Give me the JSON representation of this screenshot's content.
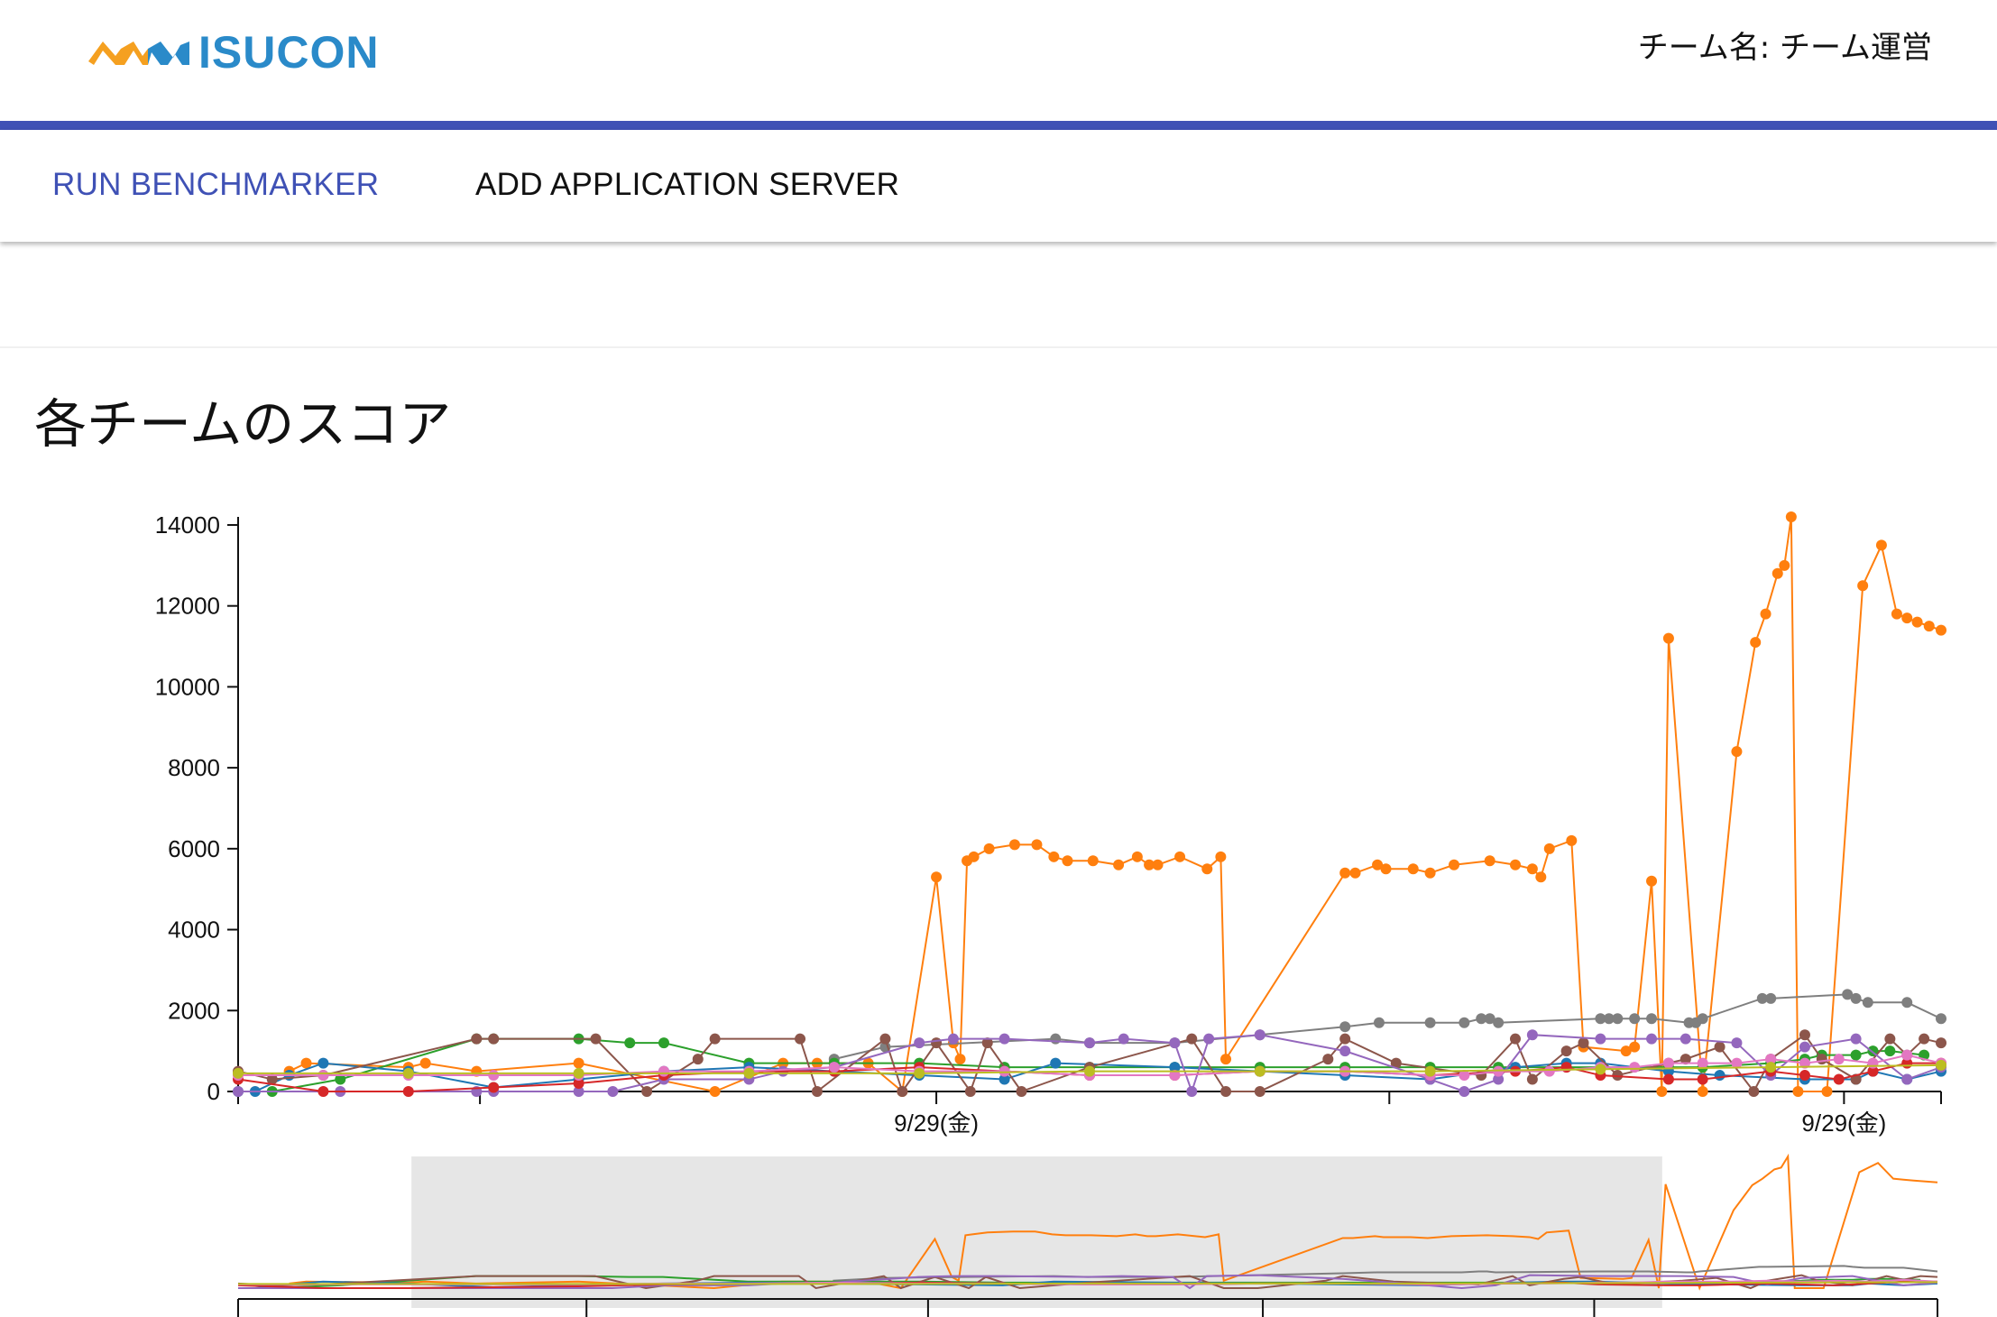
{
  "header": {
    "logo_text": "ISUCON",
    "team_name": "チーム名: チーム運営"
  },
  "tabs": [
    {
      "label": "RUN BENCHMARKER",
      "active": true
    },
    {
      "label": "ADD APPLICATION SERVER",
      "active": false
    }
  ],
  "section": {
    "title": "各チームのスコア"
  },
  "colors": {
    "accent": "#3f51b5",
    "logo_blue": "#2a8ac9",
    "logo_orange": "#f5a020",
    "brush": "#e6e6e6"
  },
  "chart_data": {
    "type": "line",
    "title": "",
    "xlabel": "",
    "ylabel": "",
    "ylim": [
      0,
      14200
    ],
    "y_ticks": [
      0,
      2000,
      4000,
      6000,
      8000,
      10000,
      12000,
      14000
    ],
    "x_range": [
      0,
      100
    ],
    "x_major_ticks": [
      {
        "x": 14.2,
        "label": ""
      },
      {
        "x": 41.0,
        "label": "9/29(金)"
      },
      {
        "x": 67.6,
        "label": ""
      },
      {
        "x": 94.3,
        "label": "9/29(金)"
      }
    ],
    "grid": false,
    "legend": "none",
    "series": [
      {
        "color": "#ff7f0e",
        "x": [
          3,
          4,
          10,
          11,
          14,
          20,
          28,
          32,
          34,
          37,
          39,
          41,
          42,
          42.4,
          42.8,
          43.2,
          44.1,
          45.6,
          46.9,
          47.9,
          48.7,
          50.2,
          51.7,
          52.8,
          53.5,
          54,
          55.3,
          56.9,
          57.7,
          58,
          65,
          65.6,
          66.9,
          67.4,
          69,
          70,
          71.4,
          73.5,
          75,
          76,
          76.5,
          77,
          78.3,
          79,
          81.5,
          82,
          83,
          83.6,
          84,
          86,
          88,
          89.1,
          89.7,
          90.4,
          90.8,
          91.2,
          91.6,
          93.3,
          95.4,
          96.5,
          97.4,
          98,
          98.6,
          99.3,
          100
        ],
        "y": [
          500,
          700,
          600,
          700,
          500,
          700,
          0,
          700,
          700,
          700,
          0,
          5300,
          1200,
          800,
          5700,
          5800,
          6000,
          6100,
          6100,
          5800,
          5700,
          5700,
          5600,
          5800,
          5600,
          5600,
          5800,
          5500,
          5800,
          800,
          5400,
          5400,
          5600,
          5500,
          5500,
          5400,
          5600,
          5700,
          5600,
          5500,
          5300,
          6000,
          6200,
          1100,
          1000,
          1100,
          5200,
          0,
          11200,
          0,
          8400,
          11100,
          11800,
          12800,
          13000,
          14200,
          0,
          0,
          12500,
          13500,
          11800,
          11700,
          11600,
          11500,
          11400
        ]
      },
      {
        "color": "#7f7f7f",
        "x": [
          35,
          38,
          48,
          50,
          55,
          60,
          65,
          67,
          70,
          72,
          73,
          73.5,
          74,
          80,
          80.5,
          81,
          82,
          83,
          85.2,
          85.6,
          86,
          89.5,
          90,
          94.5,
          95,
          95.7,
          98,
          100
        ],
        "y": [
          800,
          1100,
          1300,
          1200,
          1200,
          1400,
          1600,
          1700,
          1700,
          1700,
          1800,
          1800,
          1700,
          1800,
          1800,
          1800,
          1800,
          1800,
          1700,
          1700,
          1800,
          2300,
          2300,
          2400,
          2300,
          2200,
          2200,
          1800
        ]
      },
      {
        "color": "#2ca02c",
        "x": [
          2,
          6,
          14,
          15,
          20,
          23,
          25,
          30,
          35,
          40,
          45,
          50,
          55,
          60,
          65,
          70,
          74,
          80,
          84,
          86,
          90,
          92,
          93,
          95,
          96,
          97,
          99
        ],
        "y": [
          0,
          300,
          1300,
          1300,
          1300,
          1200,
          1200,
          700,
          700,
          700,
          600,
          600,
          600,
          600,
          600,
          600,
          600,
          600,
          600,
          600,
          700,
          800,
          900,
          900,
          1000,
          1000,
          900
        ]
      },
      {
        "color": "#1f77b4",
        "x": [
          0,
          1,
          3,
          5,
          10,
          15,
          20,
          25,
          30,
          35,
          40,
          45,
          48,
          55,
          60,
          65,
          70,
          75,
          78,
          80,
          84,
          87,
          92,
          95,
          96,
          98,
          100
        ],
        "y": [
          0,
          0,
          400,
          700,
          500,
          100,
          300,
          500,
          600,
          500,
          400,
          300,
          700,
          600,
          500,
          400,
          300,
          600,
          700,
          700,
          500,
          400,
          300,
          300,
          500,
          300,
          500
        ]
      },
      {
        "color": "#8c564b",
        "x": [
          0,
          2,
          5,
          14,
          15,
          21,
          24,
          27,
          28,
          33,
          34,
          38,
          39,
          41,
          43,
          44,
          46,
          50,
          56,
          58,
          60,
          64,
          65,
          68,
          73,
          75,
          76,
          78,
          79,
          81,
          84,
          85,
          87,
          89,
          90,
          92,
          93,
          95,
          97,
          98,
          99,
          100
        ],
        "y": [
          500,
          300,
          400,
          1300,
          1300,
          1300,
          0,
          800,
          1300,
          1300,
          0,
          1300,
          0,
          1200,
          0,
          1200,
          0,
          600,
          1300,
          0,
          0,
          800,
          1300,
          700,
          400,
          1300,
          300,
          1000,
          1200,
          400,
          700,
          800,
          1100,
          0,
          800,
          1400,
          800,
          300,
          1300,
          900,
          1300,
          1200
        ]
      },
      {
        "color": "#9467bd",
        "x": [
          0,
          6,
          14,
          15,
          20,
          22,
          25,
          30,
          32,
          35,
          40,
          42,
          45,
          50,
          52,
          55,
          56,
          57,
          60,
          65,
          70,
          72,
          74,
          76,
          80,
          83,
          85,
          88,
          90,
          92,
          95,
          98,
          100
        ],
        "y": [
          0,
          0,
          0,
          0,
          0,
          0,
          300,
          300,
          500,
          600,
          1200,
          1300,
          1300,
          1200,
          1300,
          1200,
          0,
          1300,
          1400,
          1000,
          300,
          0,
          300,
          1400,
          1300,
          1300,
          1300,
          1200,
          400,
          1100,
          1300,
          300,
          600
        ]
      },
      {
        "color": "#d62728",
        "x": [
          0,
          5,
          10,
          15,
          20,
          25,
          30,
          35,
          40,
          45,
          50,
          55,
          60,
          65,
          70,
          75,
          78,
          80,
          84,
          86,
          90,
          92,
          94,
          96,
          98,
          100
        ],
        "y": [
          300,
          0,
          0,
          100,
          200,
          400,
          500,
          500,
          600,
          500,
          400,
          400,
          500,
          500,
          400,
          500,
          600,
          400,
          300,
          300,
          500,
          400,
          300,
          500,
          700,
          700
        ]
      },
      {
        "color": "#e377c2",
        "x": [
          0,
          5,
          10,
          15,
          20,
          25,
          30,
          35,
          40,
          45,
          50,
          55,
          60,
          65,
          70,
          72,
          74,
          77,
          80,
          82,
          84,
          86,
          88,
          90,
          92,
          94,
          96,
          98,
          100
        ],
        "y": [
          400,
          400,
          400,
          400,
          400,
          500,
          500,
          600,
          500,
          500,
          400,
          400,
          500,
          500,
          400,
          400,
          500,
          500,
          600,
          600,
          700,
          700,
          700,
          800,
          700,
          800,
          700,
          900,
          700
        ]
      },
      {
        "color": "#bcbd22",
        "x": [
          0,
          10,
          20,
          30,
          40,
          50,
          60,
          70,
          80,
          90,
          100
        ],
        "y": [
          450,
          450,
          450,
          450,
          450,
          500,
          500,
          500,
          550,
          600,
          650
        ]
      }
    ]
  }
}
